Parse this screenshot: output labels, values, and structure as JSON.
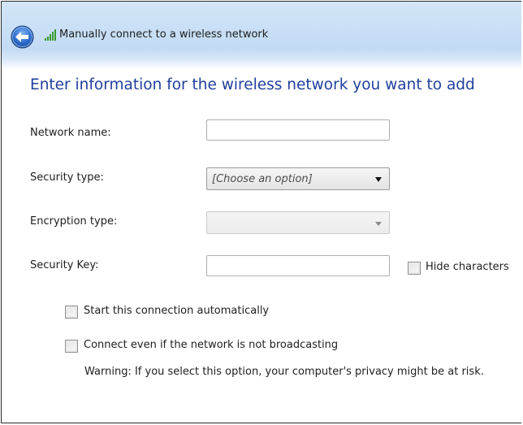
{
  "window": {
    "title": "Manually connect to a wireless network"
  },
  "heading": "Enter information for the wireless network you want to add",
  "form": {
    "network_name": {
      "label": "Network name:",
      "value": ""
    },
    "security_type": {
      "label": "Security type:",
      "selected": "[Choose an option]"
    },
    "encryption_type": {
      "label": "Encryption type:",
      "selected": ""
    },
    "security_key": {
      "label": "Security Key:",
      "value": ""
    },
    "hide_characters": {
      "label": "Hide characters",
      "checked": false
    }
  },
  "options": {
    "start_automatically": {
      "label": "Start this connection automatically",
      "checked": false
    },
    "connect_not_broadcasting": {
      "label": "Connect even if the network is not broadcasting",
      "checked": false
    },
    "warning": "Warning: If you select this option, your computer's privacy might be at risk."
  },
  "icons": {
    "back": "back-arrow-icon",
    "network": "wireless-signal-icon"
  },
  "colors": {
    "heading": "#1f3f9e",
    "back_button": "#2f6fce"
  }
}
